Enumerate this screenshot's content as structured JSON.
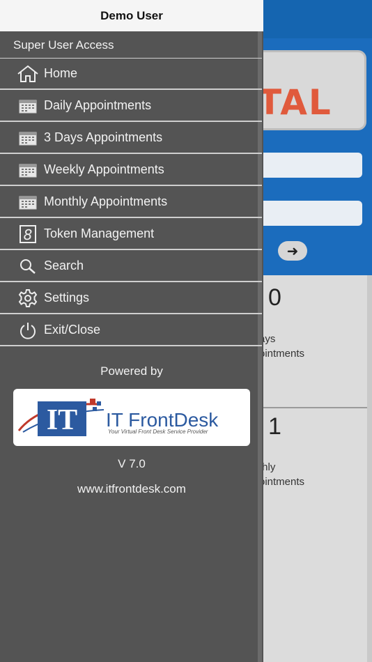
{
  "drawer": {
    "header": "Demo User",
    "section_label": "Super User Access",
    "items": [
      {
        "label": "Home",
        "icon": "home-icon"
      },
      {
        "label": "Daily Appointments",
        "icon": "calendar-icon"
      },
      {
        "label": "3 Days Appointments",
        "icon": "calendar-icon"
      },
      {
        "label": "Weekly Appointments",
        "icon": "calendar-icon"
      },
      {
        "label": "Monthly Appointments",
        "icon": "calendar-icon"
      },
      {
        "label": "Token Management",
        "icon": "token-icon"
      },
      {
        "label": "Search",
        "icon": "search-icon"
      },
      {
        "label": "Settings",
        "icon": "gear-icon"
      },
      {
        "label": "Exit/Close",
        "icon": "power-icon"
      }
    ],
    "powered_by": "Powered by",
    "company_logo": {
      "name": "IT FrontDesk",
      "tagline": "Your Virtual Front Desk Service Provider"
    },
    "version": "V 7.0",
    "website": "www.itfrontdesk.com"
  },
  "background": {
    "logo_fragment": "TAL",
    "card1": {
      "count": "0",
      "label": "ays\nointments"
    },
    "card2": {
      "count": "1",
      "label": "thly\nointments"
    }
  },
  "colors": {
    "drawer_bg": "#545454",
    "header_bg": "#f5f5f5",
    "app_blue": "#1b6cbd"
  }
}
